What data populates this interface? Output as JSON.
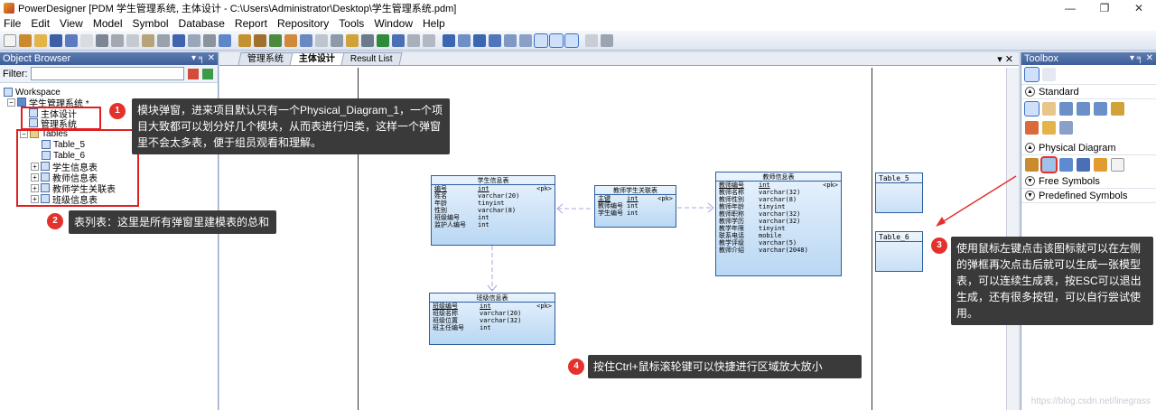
{
  "window": {
    "title": "PowerDesigner [PDM 学生管理系统, 主体设计 - C:\\Users\\Administrator\\Desktop\\学生管理系统.pdm]",
    "controls": [
      "—",
      "❐",
      "✕"
    ]
  },
  "menu": [
    "File",
    "Edit",
    "View",
    "Model",
    "Symbol",
    "Database",
    "Report",
    "Repository",
    "Tools",
    "Window",
    "Help"
  ],
  "object_browser": {
    "title": "Object Browser",
    "filter_label": "Filter:",
    "tree": {
      "workspace": "Workspace",
      "model": "学生管理系统 *",
      "diagram1": "主体设计",
      "diagram2": "管理系统",
      "tables": "Tables",
      "items": [
        "Table_5",
        "Table_6",
        "学生信息表",
        "教师信息表",
        "教师学生关联表",
        "班级信息表"
      ]
    }
  },
  "document": {
    "tabs": [
      "管理系统",
      "主体设计",
      "Result List"
    ],
    "active_tab": "主体设计",
    "close": "▾ ✕"
  },
  "entities": {
    "student": {
      "title": "学生信息表",
      "rows": [
        [
          "编号",
          "int",
          "<pk>"
        ],
        [
          "姓名",
          "varchar(20)",
          ""
        ],
        [
          "年龄",
          "tinyint",
          ""
        ],
        [
          "性别",
          "varchar(8)",
          ""
        ],
        [
          "班级编号",
          "int",
          ""
        ],
        [
          "监护人编号",
          "int",
          ""
        ]
      ]
    },
    "link": {
      "title": "教师学生关联表",
      "rows": [
        [
          "主键",
          "int",
          "<pk>"
        ],
        [
          "教师编号",
          "int",
          ""
        ],
        [
          "学生编号",
          "int",
          ""
        ]
      ]
    },
    "teacher": {
      "title": "教师信息表",
      "rows": [
        [
          "教师编号",
          "int",
          "<pk>"
        ],
        [
          "教师名称",
          "varchar(32)",
          ""
        ],
        [
          "教师性别",
          "varchar(8)",
          ""
        ],
        [
          "教师年龄",
          "tinyint",
          ""
        ],
        [
          "教师职称",
          "varchar(32)",
          ""
        ],
        [
          "教师学历",
          "varchar(32)",
          ""
        ],
        [
          "教学年限",
          "tinyint",
          ""
        ],
        [
          "联系电话",
          "mobile",
          ""
        ],
        [
          "教学评级",
          "varchar(5)",
          ""
        ],
        [
          "教师介绍",
          "varchar(2048)",
          ""
        ]
      ]
    },
    "class": {
      "title": "班级信息表",
      "rows": [
        [
          "班级编号",
          "int",
          "<pk>"
        ],
        [
          "班级名称",
          "varchar(20)",
          ""
        ],
        [
          "班级位置",
          "varchar(32)",
          ""
        ],
        [
          "班主任编号",
          "int",
          ""
        ]
      ]
    },
    "table5": "Table_5",
    "table6": "Table_6"
  },
  "toolbox": {
    "title": "Toolbox",
    "sections": [
      "Standard",
      "Physical Diagram",
      "Free Symbols",
      "Predefined Symbols"
    ]
  },
  "callouts": [
    {
      "num": "1",
      "text": "模块弹窗，进来项目默认只有一个Physical_Diagram_1，一个项目大致都可以划分好几个模块，从而表进行归类，这样一个弹窗里不会太多表，便于组员观看和理解。"
    },
    {
      "num": "2",
      "text": "表列表：这里是所有弹窗里建模表的总和"
    },
    {
      "num": "3",
      "text": "使用鼠标左键点击该图标就可以在左侧的弹框再次点击后就可以生成一张模型表，可以连续生成表，按ESC可以退出生成，还有很多按钮，可以自行尝试使用。"
    },
    {
      "num": "4",
      "text": "按住Ctrl+鼠标滚轮键可以快捷进行区域放大放小"
    }
  ],
  "watermark": "https://blog.csdn.net/linegrass",
  "colors": {
    "accent": "#e4312b",
    "callout_bg": "#3a3a3a",
    "entity_border": "#2c5f9e"
  }
}
